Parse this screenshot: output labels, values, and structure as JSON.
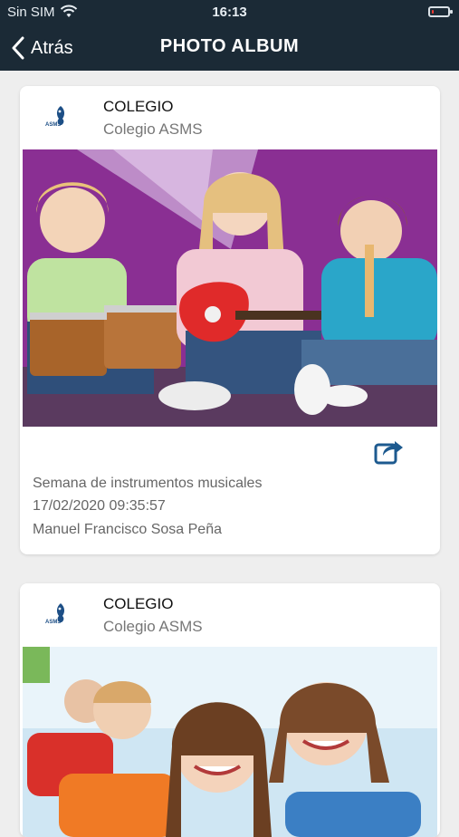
{
  "status_bar": {
    "carrier": "Sin SIM",
    "time": "16:13",
    "battery_level": 0.15
  },
  "nav": {
    "back_label": "Atrás",
    "title": "PHOTO ALBUM"
  },
  "colors": {
    "header_bg": "#1b2a36",
    "accent": "#1d4f86",
    "page_bg": "#eeeeee"
  },
  "posts": [
    {
      "school_name": "COLEGIO",
      "school_subtitle": "Colegio ASMS",
      "logo_text": "ASMS",
      "photo_alt": "Semana de instrumentos musicales",
      "share_icon": "share-icon",
      "caption": "Semana de instrumentos musicales",
      "date": "17/02/2020 09:35:57",
      "author": "Manuel Francisco Sosa Peña"
    },
    {
      "school_name": "COLEGIO",
      "school_subtitle": "Colegio ASMS",
      "logo_text": "ASMS"
    }
  ]
}
